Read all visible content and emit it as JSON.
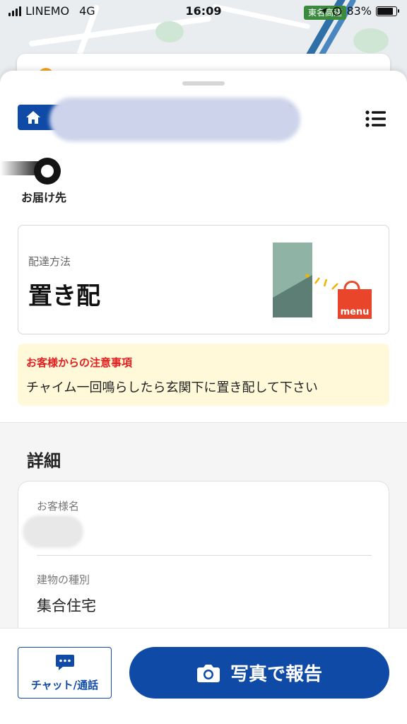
{
  "status_bar": {
    "carrier": "LINEMO",
    "network": "4G",
    "time": "16:09",
    "battery": "83%",
    "battery_level": 0.83
  },
  "map": {
    "highway_label": "東名高速"
  },
  "sheet": {
    "destination_label": "お届け先",
    "delivery_method": {
      "label": "配達方法",
      "value": "置き配",
      "illustration_brand": "menu"
    },
    "notice": {
      "title": "お客様からの注意事項",
      "text": "チャイム一回鳴らしたら玄関下に置き配して下さい"
    },
    "details": {
      "title": "詳細",
      "customer_name_label": "お客様名",
      "building_type_label": "建物の種別",
      "building_type_value": "集合住宅"
    }
  },
  "actions": {
    "chat_label": "チャット/通話",
    "report_label": "写真で報告"
  },
  "colors": {
    "primary": "#0f4aa6",
    "notice_bg": "#fff8d9",
    "notice_title": "#e02020"
  }
}
